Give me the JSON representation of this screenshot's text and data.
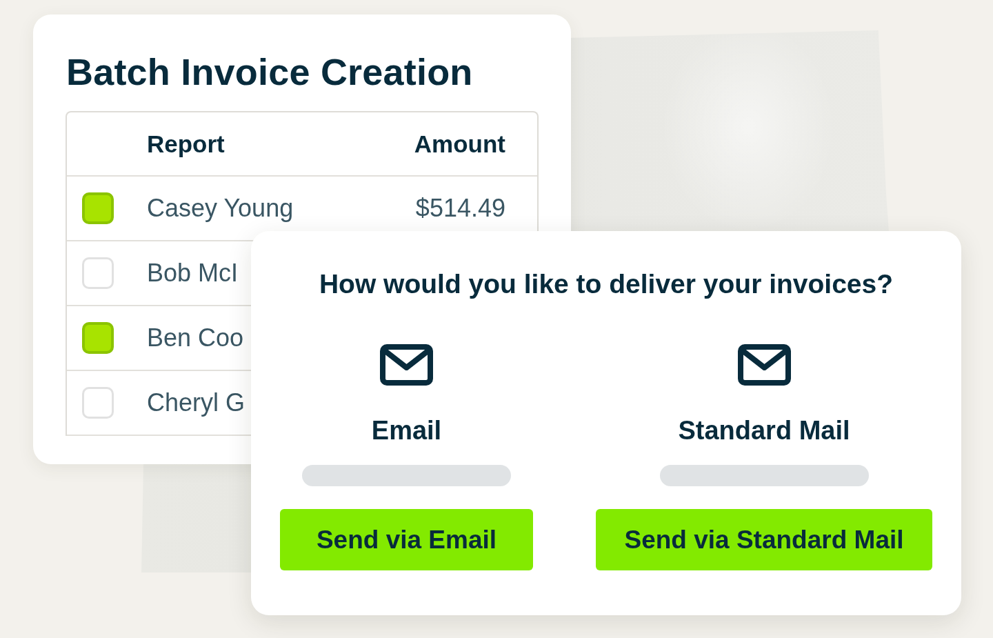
{
  "batch_card": {
    "title": "Batch Invoice Creation",
    "table": {
      "columns": [
        "Report",
        "Amount"
      ],
      "rows": [
        {
          "checked": true,
          "report": "Casey Young",
          "amount": "$514.49"
        },
        {
          "checked": false,
          "report": "Bob McI"
        },
        {
          "checked": true,
          "report": "Ben Coo"
        },
        {
          "checked": false,
          "report": "Cheryl G"
        }
      ]
    }
  },
  "delivery_dialog": {
    "question": "How would you like to deliver your invoices?",
    "options": [
      {
        "label": "Email",
        "button": "Send via Email"
      },
      {
        "label": "Standard Mail",
        "button": "Send via Standard Mail"
      }
    ]
  }
}
